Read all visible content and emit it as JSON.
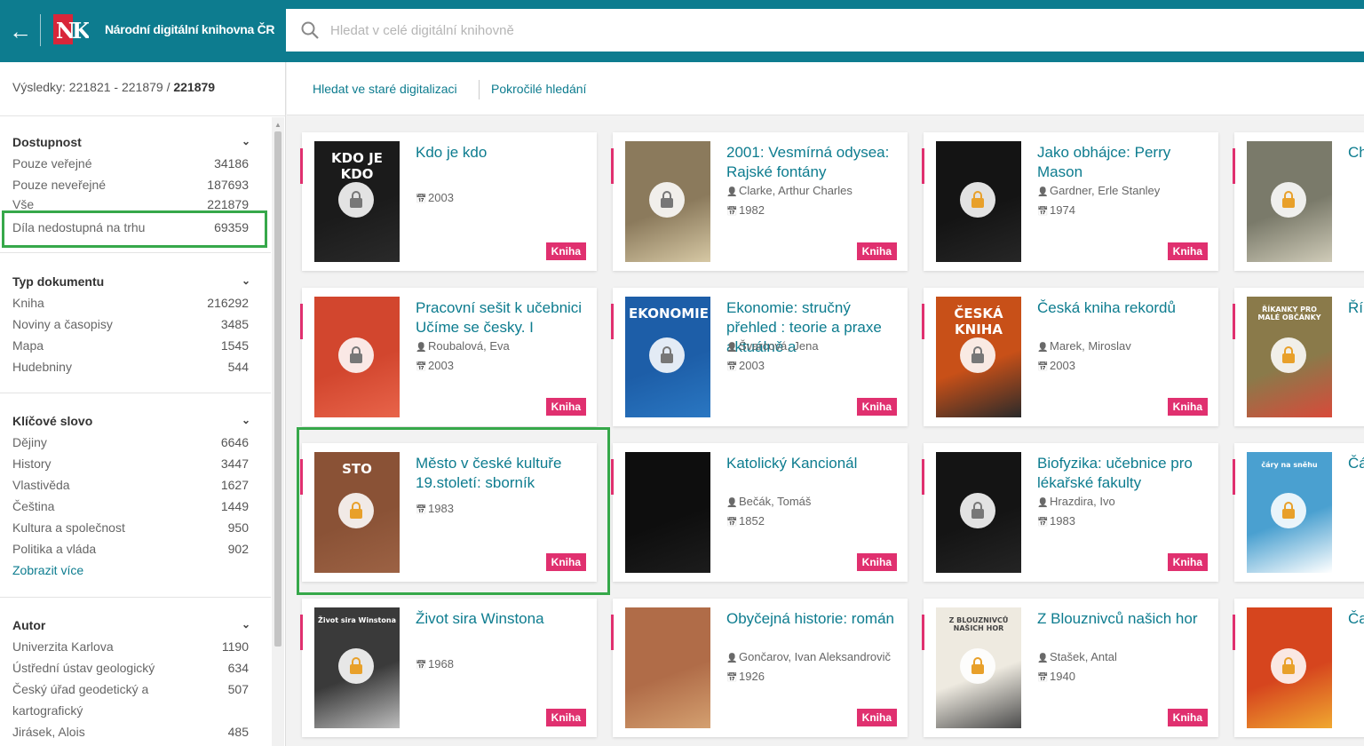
{
  "header": {
    "back_icon": "arrow-left-icon",
    "logo_text": "NK",
    "app_title": "Národní digitální knihovna ČR",
    "search_placeholder": "Hledat v celé digitální knihovně",
    "colors": {
      "primary": "#0d7c8f",
      "accent": "#e0306f",
      "highlight": "#36a84a"
    }
  },
  "results": {
    "label": "Výsledky: 221821 - 221879 / ",
    "total": "221879"
  },
  "subnav": {
    "old_search": "Hledat ve staré digitalizaci",
    "advanced_search": "Pokročilé hledání"
  },
  "facets": {
    "availability": {
      "title": "Dostupnost",
      "items": [
        {
          "label": "Pouze veřejné",
          "count": "34186"
        },
        {
          "label": "Pouze neveřejné",
          "count": "187693"
        },
        {
          "label": "Vše",
          "count": "221879"
        },
        {
          "label": "Díla nedostupná na trhu",
          "count": "69359"
        }
      ]
    },
    "doctype": {
      "title": "Typ dokumentu",
      "items": [
        {
          "label": "Kniha",
          "count": "216292"
        },
        {
          "label": "Noviny a časopisy",
          "count": "3485"
        },
        {
          "label": "Mapa",
          "count": "1545"
        },
        {
          "label": "Hudebniny",
          "count": "544"
        }
      ]
    },
    "keyword": {
      "title": "Klíčové slovo",
      "items": [
        {
          "label": "Dějiny",
          "count": "6646"
        },
        {
          "label": "History",
          "count": "3447"
        },
        {
          "label": "Vlastivěda",
          "count": "1627"
        },
        {
          "label": "Čeština",
          "count": "1449"
        },
        {
          "label": "Kultura a společnost",
          "count": "950"
        },
        {
          "label": "Politika a vláda",
          "count": "902"
        }
      ],
      "show_more": "Zobrazit více"
    },
    "author": {
      "title": "Autor",
      "items": [
        {
          "label": "Univerzita Karlova",
          "count": "1190"
        },
        {
          "label": "Ústřední ústav geologický",
          "count": "634"
        },
        {
          "label": "Český úřad geodetický a",
          "count": "507"
        },
        {
          "label": "kartografický",
          "count": ""
        },
        {
          "label": "Jirásek, Alois",
          "count": "485"
        }
      ]
    }
  },
  "cards": [
    {
      "title": "Kdo je kdo",
      "author": "",
      "year": "2003",
      "tag": "Kniha",
      "cover_text": "KDO JE KDO",
      "lock": "gray"
    },
    {
      "title": "2001: Vesmírná odysea: Rajské fontány",
      "author": "Clarke, Arthur Charles",
      "year": "1982",
      "tag": "Kniha",
      "cover_text": "",
      "lock": "gray"
    },
    {
      "title": "Jako obhájce: Perry Mason",
      "author": "Gardner, Erle Stanley",
      "year": "1974",
      "tag": "Kniha",
      "cover_text": "",
      "lock": "orange"
    },
    {
      "title": "Ch ko",
      "author": "",
      "year": "",
      "tag": "",
      "cover_text": "",
      "lock": "orange"
    },
    {
      "title": "Pracovní sešit k učebnici Učíme se česky. I",
      "author": "Roubalová, Eva",
      "year": "2003",
      "tag": "Kniha",
      "cover_text": "",
      "lock": "gray"
    },
    {
      "title": "Ekonomie: stručný přehled : teorie a praxe aktuálně a",
      "author": "Švarcová, Jena",
      "year": "2003",
      "tag": "Kniha",
      "cover_text": "EKONOMIE",
      "lock": "gray"
    },
    {
      "title": "Česká kniha rekordů",
      "author": "Marek, Miroslav",
      "year": "2003",
      "tag": "Kniha",
      "cover_text": "ČESKÁ KNIHA",
      "lock": "gray"
    },
    {
      "title": "Řík",
      "author": "",
      "year": "",
      "tag": "",
      "cover_text": "ŘÍKANKY PRO MALÉ OBČÁNKY",
      "lock": "orange"
    },
    {
      "title": "Město v české kultuře 19.století: sborník",
      "author": "",
      "year": "1983",
      "tag": "Kniha",
      "cover_text": "STO",
      "lock": "orange"
    },
    {
      "title": "Katolický Kancionál",
      "author": "Bečák, Tomáš",
      "year": "1852",
      "tag": "Kniha",
      "cover_text": "",
      "lock": "none"
    },
    {
      "title": "Biofyzika: učebnice pro lékařské fakulty",
      "author": "Hrazdira, Ivo",
      "year": "1983",
      "tag": "Kniha",
      "cover_text": "",
      "lock": "gray"
    },
    {
      "title": "Čá",
      "author": "",
      "year": "",
      "tag": "",
      "cover_text": "čáry na sněhu",
      "lock": "orange"
    },
    {
      "title": "Život sira Winstona",
      "author": "",
      "year": "1968",
      "tag": "Kniha",
      "cover_text": "Život sira Winstona",
      "lock": "orange"
    },
    {
      "title": "Obyčejná historie: román",
      "author": "Gončarov, Ivan Aleksandrovič",
      "year": "1926",
      "tag": "Kniha",
      "cover_text": "",
      "lock": "none"
    },
    {
      "title": "Z Blouznivců našich hor",
      "author": "Stašek, Antal",
      "year": "1940",
      "tag": "Kniha",
      "cover_text": "Z BLOUZNIVCŮ NAŠICH HOR",
      "lock": "orange"
    },
    {
      "title": "Ča",
      "author": "",
      "year": "",
      "tag": "",
      "cover_text": "",
      "lock": "orange"
    }
  ]
}
